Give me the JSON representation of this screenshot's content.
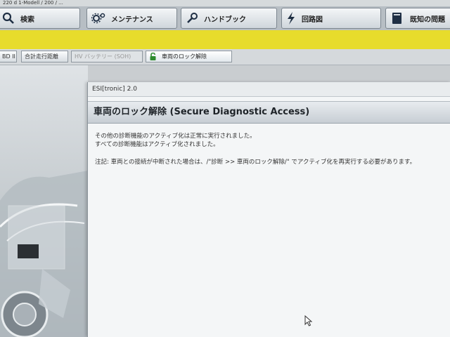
{
  "top_strip": {
    "text": "220 d 1-Modell / 200 / ..."
  },
  "toolbar": {
    "search_label": "検索",
    "maintenance_label": "メンテナンス",
    "handbook_label": "ハンドブック",
    "circuit_label": "回路図",
    "known_issues_label": "既知の問題"
  },
  "tabs": [
    {
      "label": "BD II"
    },
    {
      "label": "合計走行距離"
    },
    {
      "label": "HV バッテリー (SOH)"
    },
    {
      "label": "車両のロック解除"
    }
  ],
  "dialog": {
    "window_title": "ESI[tronic] 2.0",
    "header": "車両のロック解除 (Secure Diagnostic Access)",
    "line1": "その他の診断機能のアクティブ化は正常に実行されました。",
    "line2": "すべての診断機能はアクティブ化されました。",
    "note": "注記: 車両との接続が中断された場合は、/\"診断 >> 車両のロック解除/\" でアクティブ化を再実行する必要があります。"
  },
  "colors": {
    "accent_yellow": "#e7dc2c",
    "toolbar_gray": "#b7bec4",
    "dialog_header": "#c7ced4"
  }
}
